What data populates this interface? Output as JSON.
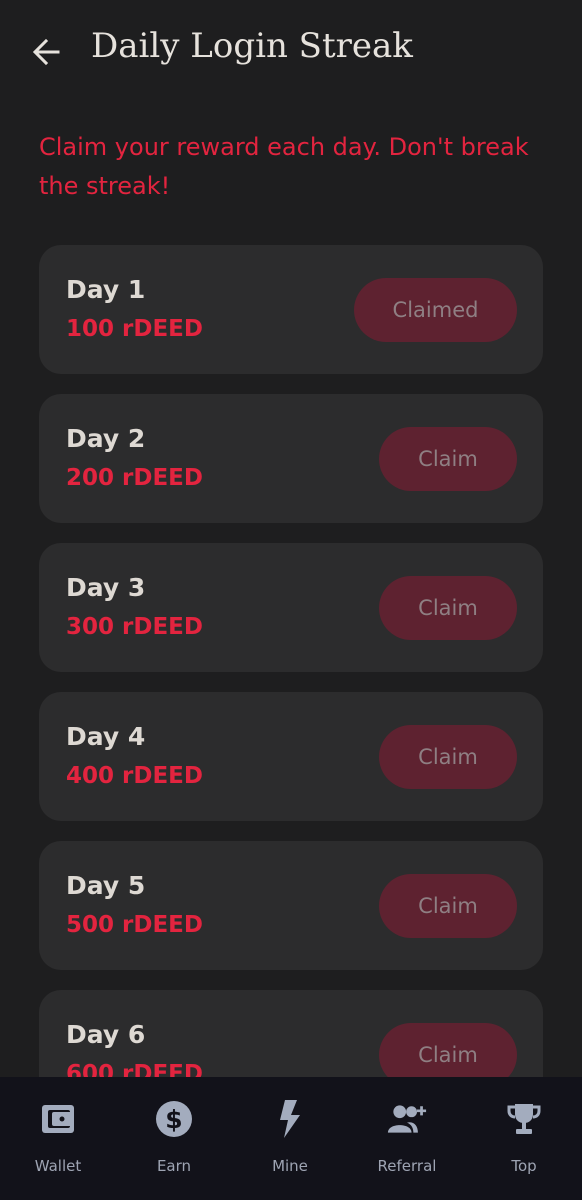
{
  "header": {
    "title": "Daily Login Streak",
    "back_icon": "arrow-left-icon"
  },
  "subtitle": "Claim your reward each day. Don't break the streak!",
  "colors": {
    "background": "#1e1e1f",
    "card": "#2c2c2d",
    "accent": "#e3243f",
    "button_bg": "#5e2230",
    "nav_bg": "#12121a",
    "nav_icon": "#a3acbe"
  },
  "days": [
    {
      "day": "Day 1",
      "reward": "100 rDEED",
      "button": "Claimed"
    },
    {
      "day": "Day 2",
      "reward": "200 rDEED",
      "button": "Claim"
    },
    {
      "day": "Day 3",
      "reward": "300 rDEED",
      "button": "Claim"
    },
    {
      "day": "Day 4",
      "reward": "400 rDEED",
      "button": "Claim"
    },
    {
      "day": "Day 5",
      "reward": "500 rDEED",
      "button": "Claim"
    },
    {
      "day": "Day 6",
      "reward": "600 rDEED",
      "button": "Claim"
    }
  ],
  "nav": [
    {
      "label": "Wallet",
      "icon": "wallet-icon"
    },
    {
      "label": "Earn",
      "icon": "dollar-coin-icon"
    },
    {
      "label": "Mine",
      "icon": "lightning-bolt-icon"
    },
    {
      "label": "Referral",
      "icon": "add-user-icon"
    },
    {
      "label": "Top",
      "icon": "trophy-icon"
    }
  ]
}
